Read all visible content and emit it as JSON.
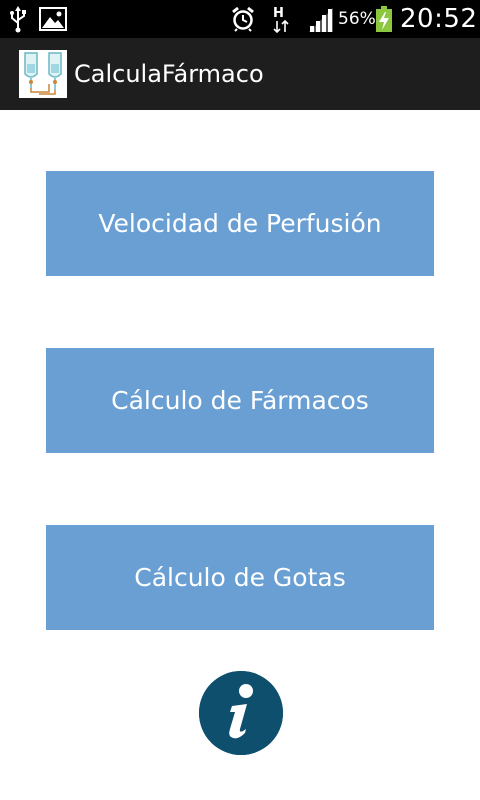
{
  "status_bar": {
    "icons": [
      "usb-icon",
      "image-icon",
      "alarm-icon",
      "h-plus-data-icon",
      "signal-icon",
      "battery-charging-icon"
    ],
    "battery_percent": "56%",
    "time": "20:52"
  },
  "action_bar": {
    "title": "CalculaFármaco",
    "icon": "iv-drip-icon"
  },
  "menu": {
    "buttons": [
      {
        "label": "Velocidad de Perfusión"
      },
      {
        "label": "Cálculo de Fármacos"
      },
      {
        "label": "Cálculo de Gotas"
      }
    ],
    "info_icon": "info-icon"
  },
  "colors": {
    "button_bg": "#6a9fd4",
    "info_bg": "#0f4f6e",
    "action_bar_bg": "#1e1e1e",
    "status_bar_bg": "#000000",
    "battery_green": "#8dc63f"
  }
}
